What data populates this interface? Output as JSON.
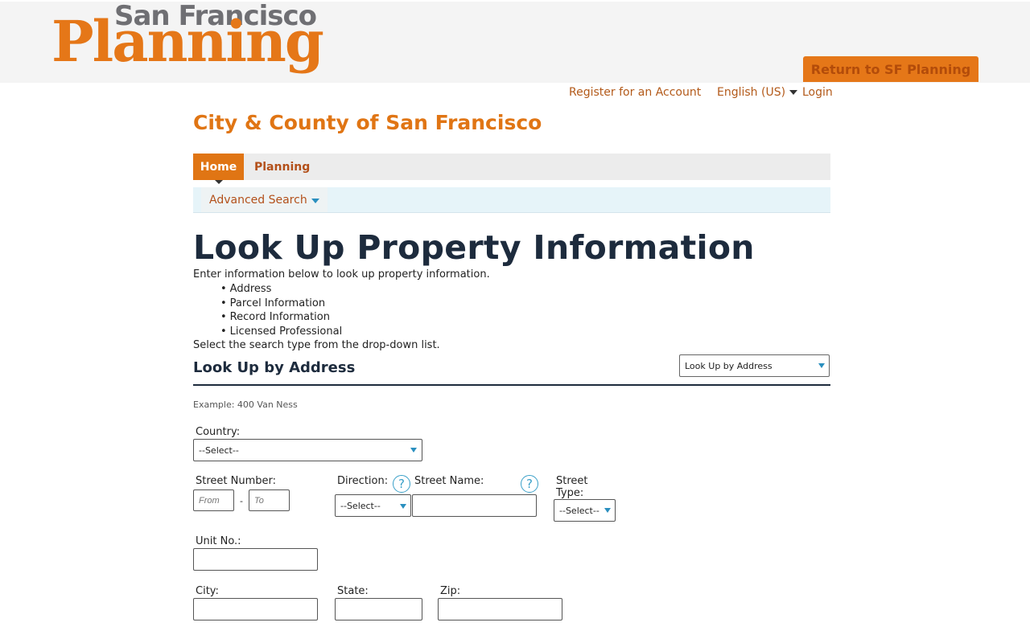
{
  "header": {
    "logo_line1": "San Francisco",
    "logo_line2": "Planning",
    "return_button": "Return to SF Planning",
    "brand_color": "#e57718"
  },
  "utility": {
    "register": "Register for an Account",
    "language": "English (US)",
    "login": "Login"
  },
  "agency_title": "City & County of San Francisco",
  "nav": {
    "tabs": [
      {
        "label": "Home",
        "active": true
      },
      {
        "label": "Planning",
        "active": false
      }
    ]
  },
  "subnav": {
    "item": "Advanced Search"
  },
  "page": {
    "heading": "Look Up Property Information",
    "intro": "Enter information below to look up property information.",
    "bullets": [
      "Address",
      "Parcel Information",
      "Record Information",
      "Licensed Professional"
    ],
    "select_hint": "Select the search type from the drop-down list.",
    "search_type_value": "Look Up by Address"
  },
  "section": {
    "heading": "Look Up by Address",
    "example": "Example: 400 Van Ness"
  },
  "form": {
    "country_label": "Country:",
    "country_value": "--Select--",
    "street_number_label": "Street Number:",
    "from_placeholder": "From",
    "to_placeholder": "To",
    "range_separator": "-",
    "direction_label": "Direction:",
    "direction_value": "--Select--",
    "street_name_label": "Street Name:",
    "street_type_label_1": "Street",
    "street_type_label_2": "Type:",
    "street_type_value": "--Select--",
    "unit_label": "Unit No.:",
    "city_label": "City:",
    "state_label": "State:",
    "zip_label": "Zip:"
  },
  "icons": {
    "help": "?",
    "help_icon_name": "question-circle-icon",
    "dropdown_icon_name": "chevron-down-icon"
  }
}
